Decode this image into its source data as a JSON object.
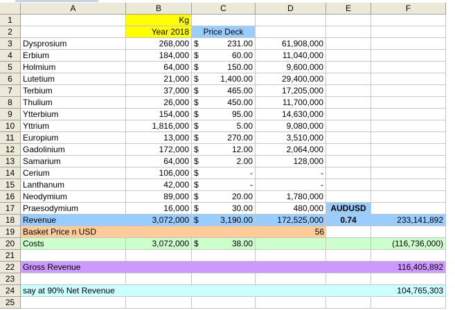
{
  "colors": {
    "header_bg": "#ece9d8",
    "yellow": "#ffff00",
    "light_blue": "#99ccff",
    "peach": "#ffcc99",
    "light_green": "#ccffcc",
    "lavender": "#cc99ff",
    "light_cyan": "#ccffff"
  },
  "column_headers": [
    "A",
    "B",
    "C",
    "D",
    "E",
    "F"
  ],
  "row_numbers": [
    "1",
    "2",
    "3",
    "4",
    "5",
    "6",
    "7",
    "8",
    "9",
    "10",
    "11",
    "12",
    "13",
    "14",
    "15",
    "16",
    "17",
    "18",
    "19",
    "20",
    "21",
    "22",
    "23",
    "24",
    "25"
  ],
  "header": {
    "kg": "Kg",
    "year": "Year 2018",
    "price_deck": "Price Deck",
    "audusd": "AUDUSD"
  },
  "elements": [
    {
      "name": "Dysprosium",
      "kg": "268,000",
      "cur": "$",
      "price": "231.00",
      "value": "61,908,000"
    },
    {
      "name": "Erbium",
      "kg": "184,000",
      "cur": "$",
      "price": "60.00",
      "value": "11,040,000"
    },
    {
      "name": "Holmium",
      "kg": "64,000",
      "cur": "$",
      "price": "150.00",
      "value": "9,600,000"
    },
    {
      "name": "Lutetium",
      "kg": "21,000",
      "cur": "$",
      "price": "1,400.00",
      "value": "29,400,000"
    },
    {
      "name": "Terbium",
      "kg": "37,000",
      "cur": "$",
      "price": "465.00",
      "value": "17,205,000"
    },
    {
      "name": "Thulium",
      "kg": "26,000",
      "cur": "$",
      "price": "450.00",
      "value": "11,700,000"
    },
    {
      "name": "Ytterbium",
      "kg": "154,000",
      "cur": "$",
      "price": "95.00",
      "value": "14,630,000"
    },
    {
      "name": "Yttrium",
      "kg": "1,816,000",
      "cur": "$",
      "price": "5.00",
      "value": "9,080,000"
    },
    {
      "name": "Europium",
      "kg": "13,000",
      "cur": "$",
      "price": "270.00",
      "value": "3,510,000"
    },
    {
      "name": "Gadolinium",
      "kg": "172,000",
      "cur": "$",
      "price": "12.00",
      "value": "2,064,000"
    },
    {
      "name": "Samarium",
      "kg": "64,000",
      "cur": "$",
      "price": "2.00",
      "value": "128,000"
    },
    {
      "name": "Cerium",
      "kg": "106,000",
      "cur": "$",
      "price": "-",
      "value": "-"
    },
    {
      "name": "Lanthanum",
      "kg": "42,000",
      "cur": "$",
      "price": "-",
      "value": "-"
    },
    {
      "name": "Neodymium",
      "kg": "89,000",
      "cur": "$",
      "price": "20.00",
      "value": "1,780,000"
    },
    {
      "name": "Praesodymium",
      "kg": "16,000",
      "cur": "$",
      "price": "30.00",
      "value": "480,000"
    }
  ],
  "revenue": {
    "label": "Revenue",
    "kg": "3,072,000",
    "cur": "$",
    "price": "3,190.00",
    "value": "172,525,000",
    "fx": "0.74",
    "usd": "233,141,892"
  },
  "basket": {
    "label": "Basket Price n USD",
    "value": "56"
  },
  "costs": {
    "label": "Costs",
    "kg": "3,072,000",
    "cur": "$",
    "price": "38.00",
    "total": "(116,736,000)"
  },
  "gross": {
    "label": "Gross Revenue",
    "value": "116,405,892"
  },
  "net": {
    "label": "say at 90% Net Revenue",
    "value": "104,765,303"
  }
}
